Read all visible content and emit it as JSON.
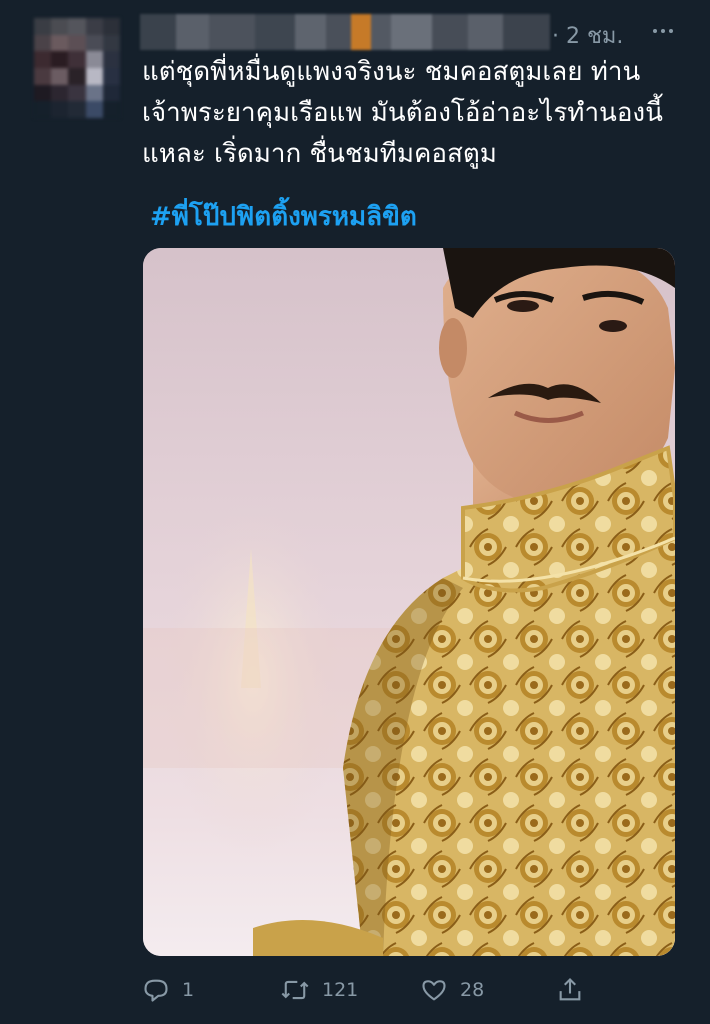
{
  "tweet": {
    "timestamp": "· 2 ชม.",
    "text_lines": [
      "แต่ชุดพี่หมื่นดูแพงจริงนะ ชมคอสตูมเลย ท่าน",
      "เจ้าพระยาคุมเรือแพ มันต้องโอ้อ่าอะไรทำนองนี้",
      "แหละ เริ่ดมาก ชื่นชมทีมคอสตูม"
    ],
    "hashtag": "#พี่โป๊ปฟิตติ้งพรหมลิขิต"
  },
  "actions": {
    "reply_count": "1",
    "retweet_count": "121",
    "like_count": "28"
  },
  "icons": {
    "more": "more-horizontal-icon",
    "reply": "reply-icon",
    "retweet": "retweet-icon",
    "like": "heart-icon",
    "share": "share-icon"
  },
  "colors": {
    "background": "#15202b",
    "text": "#ffffff",
    "secondary": "#8899a6",
    "link": "#1da1f2",
    "fabric_gold": "#c9a24a"
  }
}
